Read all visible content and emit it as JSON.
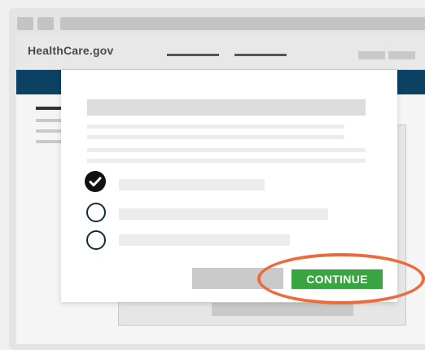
{
  "site": {
    "logo": "HealthCare.gov"
  },
  "modal": {
    "options": [
      {
        "state": "checked",
        "icon": "checkmark-icon"
      },
      {
        "state": "unchecked",
        "icon": "radio-empty-icon"
      },
      {
        "state": "unchecked",
        "icon": "radio-empty-icon"
      }
    ],
    "continue_label": "CONTINUE"
  },
  "colors": {
    "navbar": "#0b4163",
    "continue_button": "#38a541",
    "highlight_ring": "#ec6b3c"
  }
}
